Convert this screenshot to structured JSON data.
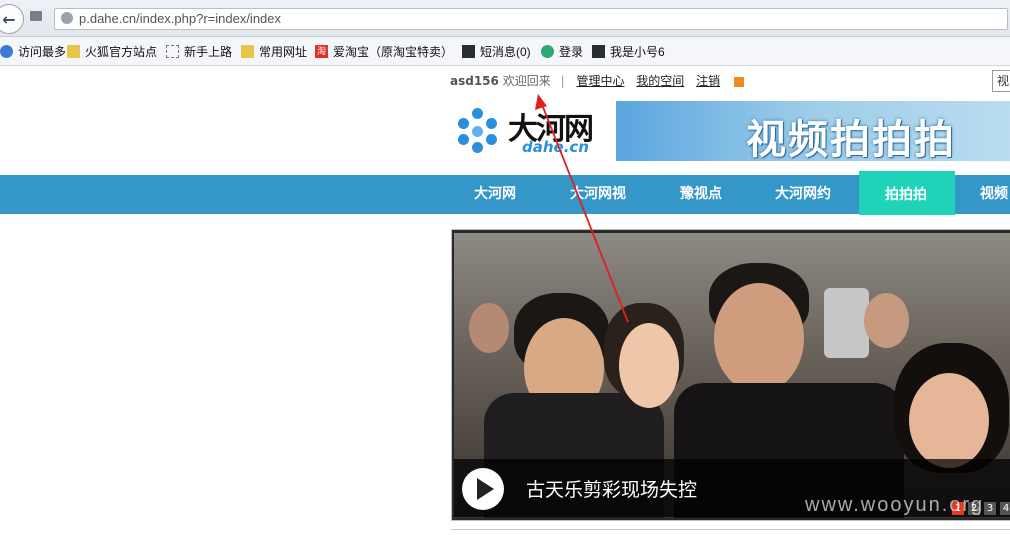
{
  "browser": {
    "url": "p.dahe.cn/index.php?r=index/index",
    "bookmarks": [
      {
        "label": "访问最多",
        "icon": "bookmark-icon"
      },
      {
        "label": "火狐官方站点",
        "icon": "folder-icon"
      },
      {
        "label": "新手上路",
        "icon": "page-icon"
      },
      {
        "label": "常用网址",
        "icon": "folder-icon"
      },
      {
        "label": "爱淘宝（原淘宝特卖）",
        "icon": "taobao-icon"
      },
      {
        "label": "短消息(0)",
        "icon": "message-icon"
      },
      {
        "label": "登录",
        "icon": "login-icon"
      },
      {
        "label": "我是小号6",
        "icon": "user-icon"
      }
    ]
  },
  "userbar": {
    "username": "asd156",
    "welcome": "欢迎回来",
    "separator": "|",
    "links": [
      "管理中心",
      "我的空间",
      "注销"
    ],
    "corner_text": "视"
  },
  "logo": {
    "name": "大河网",
    "sub": "dahe.cn"
  },
  "banner": {
    "text": "视频拍拍拍"
  },
  "nav": {
    "items": [
      "大河网",
      "大河网视",
      "豫视点",
      "大河网约",
      "拍拍拍",
      "视频"
    ],
    "active": "拍拍拍"
  },
  "slider": {
    "caption": "古天乐剪彩现场失控",
    "pages": [
      "1",
      "2",
      "3",
      "4"
    ],
    "active_page": "1"
  },
  "watermark": "www.wooyun.org",
  "colors": {
    "nav_bg": "#3596c8",
    "nav_active": "#1fd3b8",
    "annotation": "#e02020"
  }
}
